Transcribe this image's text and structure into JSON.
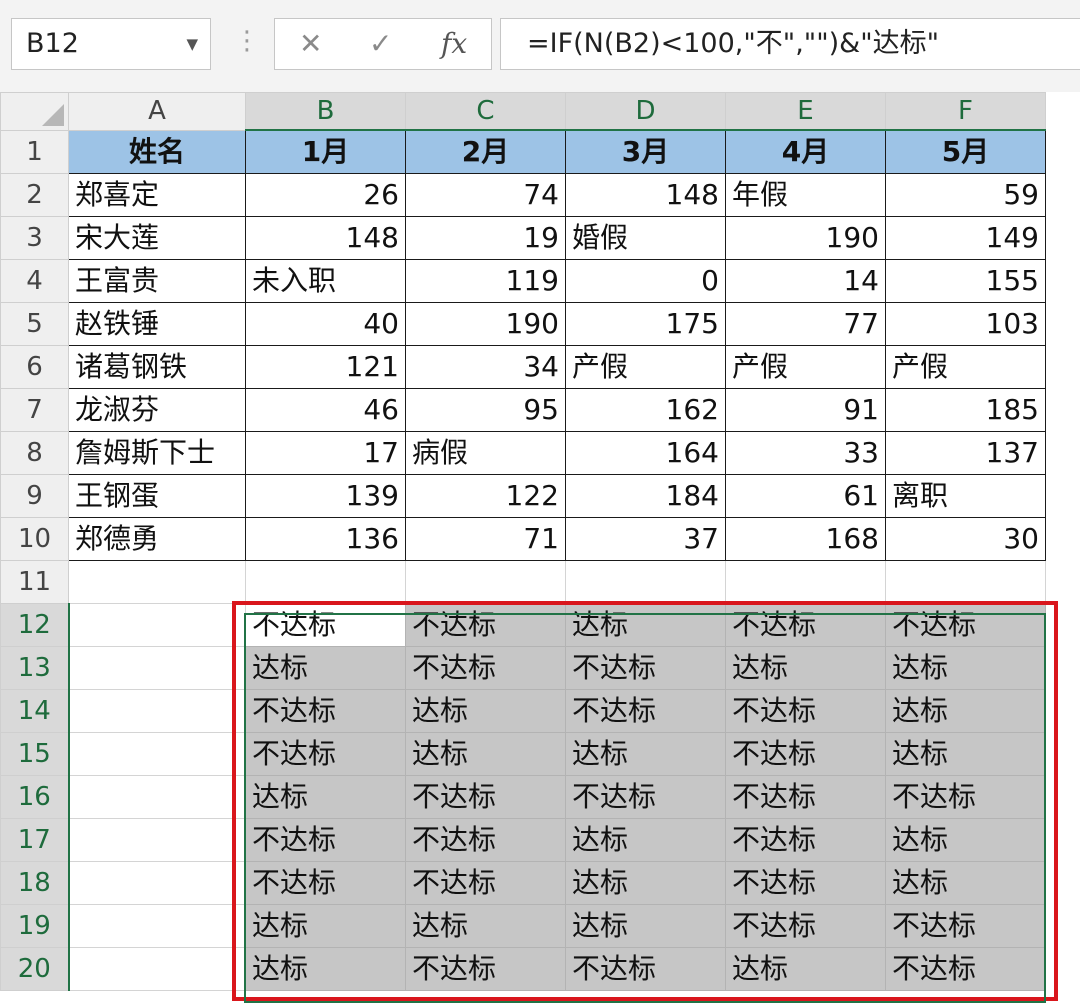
{
  "name_box": "B12",
  "formula_bar": {
    "cancel_glyph": "✕",
    "enter_glyph": "✓",
    "fx_glyph": "fx",
    "formula": "=IF(N(B2)<100,\"不\",\"\")&\"达标\""
  },
  "columns": [
    "A",
    "B",
    "C",
    "D",
    "E",
    "F"
  ],
  "rows": [
    {
      "num": "1",
      "cells": [
        "姓名",
        "1月",
        "2月",
        "3月",
        "4月",
        "5月"
      ]
    },
    {
      "num": "2",
      "cells": [
        "郑喜定",
        "26",
        "74",
        "148",
        "年假",
        "59"
      ]
    },
    {
      "num": "3",
      "cells": [
        "宋大莲",
        "148",
        "19",
        "婚假",
        "190",
        "149"
      ]
    },
    {
      "num": "4",
      "cells": [
        "王富贵",
        "未入职",
        "119",
        "0",
        "14",
        "155"
      ]
    },
    {
      "num": "5",
      "cells": [
        "赵铁锤",
        "40",
        "190",
        "175",
        "77",
        "103"
      ]
    },
    {
      "num": "6",
      "cells": [
        "诸葛钢铁",
        "121",
        "34",
        "产假",
        "产假",
        "产假"
      ]
    },
    {
      "num": "7",
      "cells": [
        "龙淑芬",
        "46",
        "95",
        "162",
        "91",
        "185"
      ]
    },
    {
      "num": "8",
      "cells": [
        "詹姆斯下士",
        "17",
        "病假",
        "164",
        "33",
        "137"
      ]
    },
    {
      "num": "9",
      "cells": [
        "王钢蛋",
        "139",
        "122",
        "184",
        "61",
        "离职"
      ]
    },
    {
      "num": "10",
      "cells": [
        "郑德勇",
        "136",
        "71",
        "37",
        "168",
        "30"
      ]
    },
    {
      "num": "11",
      "cells": [
        "",
        "",
        "",
        "",
        "",
        ""
      ]
    },
    {
      "num": "12",
      "cells": [
        "",
        "不达标",
        "不达标",
        "达标",
        "不达标",
        "不达标"
      ]
    },
    {
      "num": "13",
      "cells": [
        "",
        "达标",
        "不达标",
        "不达标",
        "达标",
        "达标"
      ]
    },
    {
      "num": "14",
      "cells": [
        "",
        "不达标",
        "达标",
        "不达标",
        "不达标",
        "达标"
      ]
    },
    {
      "num": "15",
      "cells": [
        "",
        "不达标",
        "达标",
        "达标",
        "不达标",
        "达标"
      ]
    },
    {
      "num": "16",
      "cells": [
        "",
        "达标",
        "不达标",
        "不达标",
        "不达标",
        "不达标"
      ]
    },
    {
      "num": "17",
      "cells": [
        "",
        "不达标",
        "不达标",
        "达标",
        "不达标",
        "达标"
      ]
    },
    {
      "num": "18",
      "cells": [
        "",
        "不达标",
        "不达标",
        "达标",
        "不达标",
        "达标"
      ]
    },
    {
      "num": "19",
      "cells": [
        "",
        "达标",
        "达标",
        "达标",
        "不达标",
        "不达标"
      ]
    },
    {
      "num": "20",
      "cells": [
        "",
        "达标",
        "不达标",
        "不达标",
        "达标",
        "不达标"
      ]
    }
  ],
  "colors": {
    "header_fill": "#9dc3e6",
    "selection_fill": "#c6c6c6",
    "selection_border": "#217346",
    "highlight_box": "#d9161c"
  }
}
